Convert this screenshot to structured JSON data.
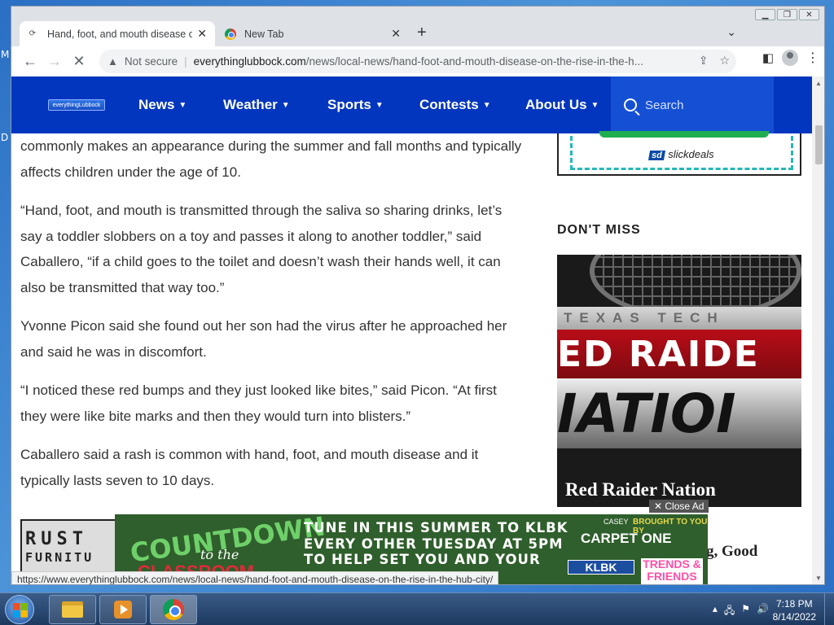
{
  "desktop": {
    "left_labels": [
      "M",
      "D"
    ]
  },
  "browser": {
    "tabs": [
      {
        "title": "Hand, foot, and mouth disease o",
        "active": true
      },
      {
        "title": "New Tab",
        "active": false
      }
    ],
    "new_tab_symbol": "+",
    "address": {
      "security": "Not secure",
      "host": "everythinglubbock.com",
      "path": "/news/local-news/hand-foot-and-mouth-disease-on-the-rise-in-the-h..."
    },
    "status_url": "https://www.everythinglubbock.com/news/local-news/hand-foot-and-mouth-disease-on-the-rise-in-the-hub-city/"
  },
  "site": {
    "logo_text": "everythingLubbock",
    "nav": [
      {
        "label": "News"
      },
      {
        "label": "Weather"
      },
      {
        "label": "Sports"
      },
      {
        "label": "Contests"
      },
      {
        "label": "About Us"
      }
    ],
    "search_placeholder": "Search"
  },
  "article": {
    "paragraphs": [
      "commonly makes an appearance during the summer and fall months and typically affects children under the age of 10.",
      "“Hand, foot, and mouth is transmitted through the saliva so sharing drinks, let’s say a toddler slobbers on a toy and passes it along to another toddler,” said Caballero, “if a child goes to the toilet and doesn’t wash their hands well, it can also be transmitted that way too.”",
      "Yvonne Picon said she found out her son had the virus after he approached her and said he was in discomfort.",
      "“I noticed these red bumps and they just looked like bites,” said Picon. “At first they were like bite marks and then they would turn into blisters.”",
      "Caballero said a rash is common with hand, foot, and mouth disease and it typically lasts seven to 10 days."
    ],
    "thumb_sign_top": "RUST",
    "thumb_sign_bottom": "FURNITU"
  },
  "sidebar": {
    "ad_brand": "slickdeals",
    "dont_miss_heading": "DON'T MISS",
    "feature": {
      "band_top": "TEXAS TECH",
      "band_mid": "ED RAIDE",
      "band_bottom": "IATIOI",
      "title": "Red Raider Nation"
    },
    "next_title_fragment": "g, Good"
  },
  "bottom_ad": {
    "close_label": "Close Ad",
    "countdown": "COUNTDOWN",
    "to_the": "to the",
    "classroom": "CLASSROOM",
    "copy_lines": [
      "TUNE IN THIS SUMMER TO KLBK",
      "EVERY OTHER TUESDAY AT 5PM",
      "TO HELP SET YOU AND YOUR"
    ],
    "casey": "CASEY",
    "brought_by": "BROUGHT TO YOU BY",
    "carpet_one": "CARPET ONE",
    "klbk": "KLBK",
    "trends": "TRENDS & FRIENDS"
  },
  "taskbar": {
    "time": "7:18 PM",
    "date": "8/14/2022"
  }
}
